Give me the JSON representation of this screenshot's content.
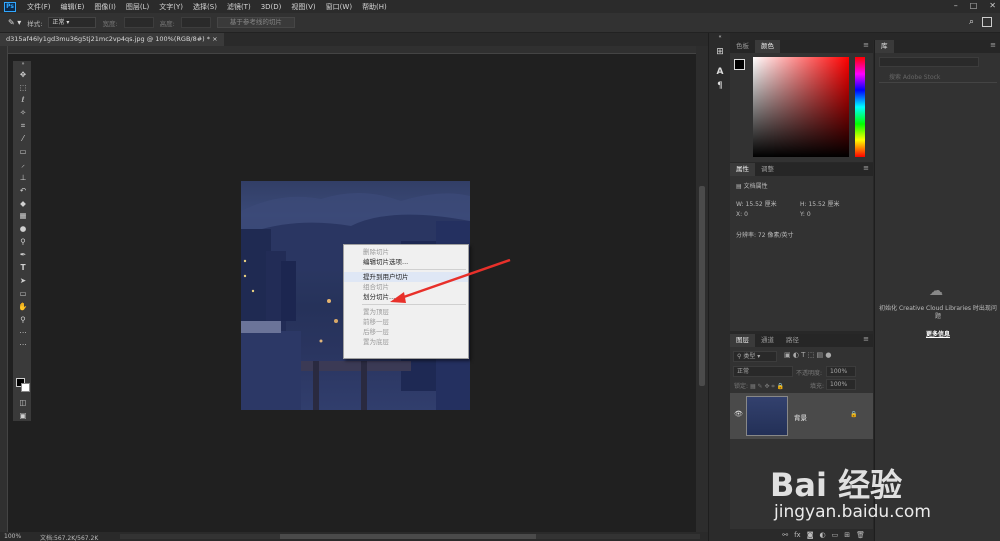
{
  "app": {
    "menu": [
      "文件(F)",
      "编辑(E)",
      "图像(I)",
      "图层(L)",
      "文字(Y)",
      "选择(S)",
      "滤镜(T)",
      "3D(D)",
      "视图(V)",
      "窗口(W)",
      "帮助(H)"
    ],
    "logo": "Ps"
  },
  "options": {
    "style_label": "样式:",
    "style_value": "正常",
    "width_label": "宽度:",
    "height_label": "高度:",
    "guides_button": "基于参考线的切片"
  },
  "document": {
    "tab_title": "d315af46ly1gd3mu36g5tj21mc2vp4qs.jpg @ 100%(RGB/8#) *",
    "zoom": "100%",
    "doc_size": "文档:567.2K/567.2K"
  },
  "context_menu": {
    "items": [
      {
        "label": "删除切片",
        "enabled": false
      },
      {
        "label": "编辑切片选项...",
        "enabled": true
      },
      {
        "label": "提升到用户切片",
        "enabled": true
      },
      {
        "label": "组合切片",
        "enabled": false
      },
      {
        "label": "划分切片...",
        "enabled": true
      },
      {
        "label": "置为顶层",
        "enabled": false
      },
      {
        "label": "前移一层",
        "enabled": false
      },
      {
        "label": "后移一层",
        "enabled": false
      },
      {
        "label": "置为底层",
        "enabled": false
      }
    ]
  },
  "panels": {
    "color": {
      "tabs": [
        "色板",
        "颜色"
      ],
      "active": "颜色"
    },
    "properties": {
      "tabs": [
        "属性",
        "调整"
      ],
      "section": "文档属性",
      "w_label": "W:",
      "w_value": "15.52 厘米",
      "h_label": "H:",
      "h_value": "15.52 厘米",
      "x_label": "X:",
      "x_value": "0",
      "y_label": "Y:",
      "y_value": "0",
      "resolution": "分辨率: 72 像素/英寸"
    },
    "layers": {
      "tabs": [
        "图层",
        "通道",
        "路径"
      ],
      "filter_label": "类型",
      "blend_mode": "正常",
      "opacity_label": "不透明度:",
      "opacity_value": "100%",
      "lock_label": "锁定:",
      "fill_label": "填充:",
      "fill_value": "100%",
      "layer_name": "背景"
    },
    "library": {
      "tab": "库",
      "search_placeholder": "搜索 Adobe Stock",
      "message": "初始化 Creative Cloud Libraries 时出现问题",
      "link": "更多信息"
    }
  },
  "watermark": {
    "logo": "Bai 经验",
    "url": "jingyan.baidu.com"
  },
  "colors": {
    "arrow": "#e8302a",
    "accent": "#31a8ff"
  }
}
